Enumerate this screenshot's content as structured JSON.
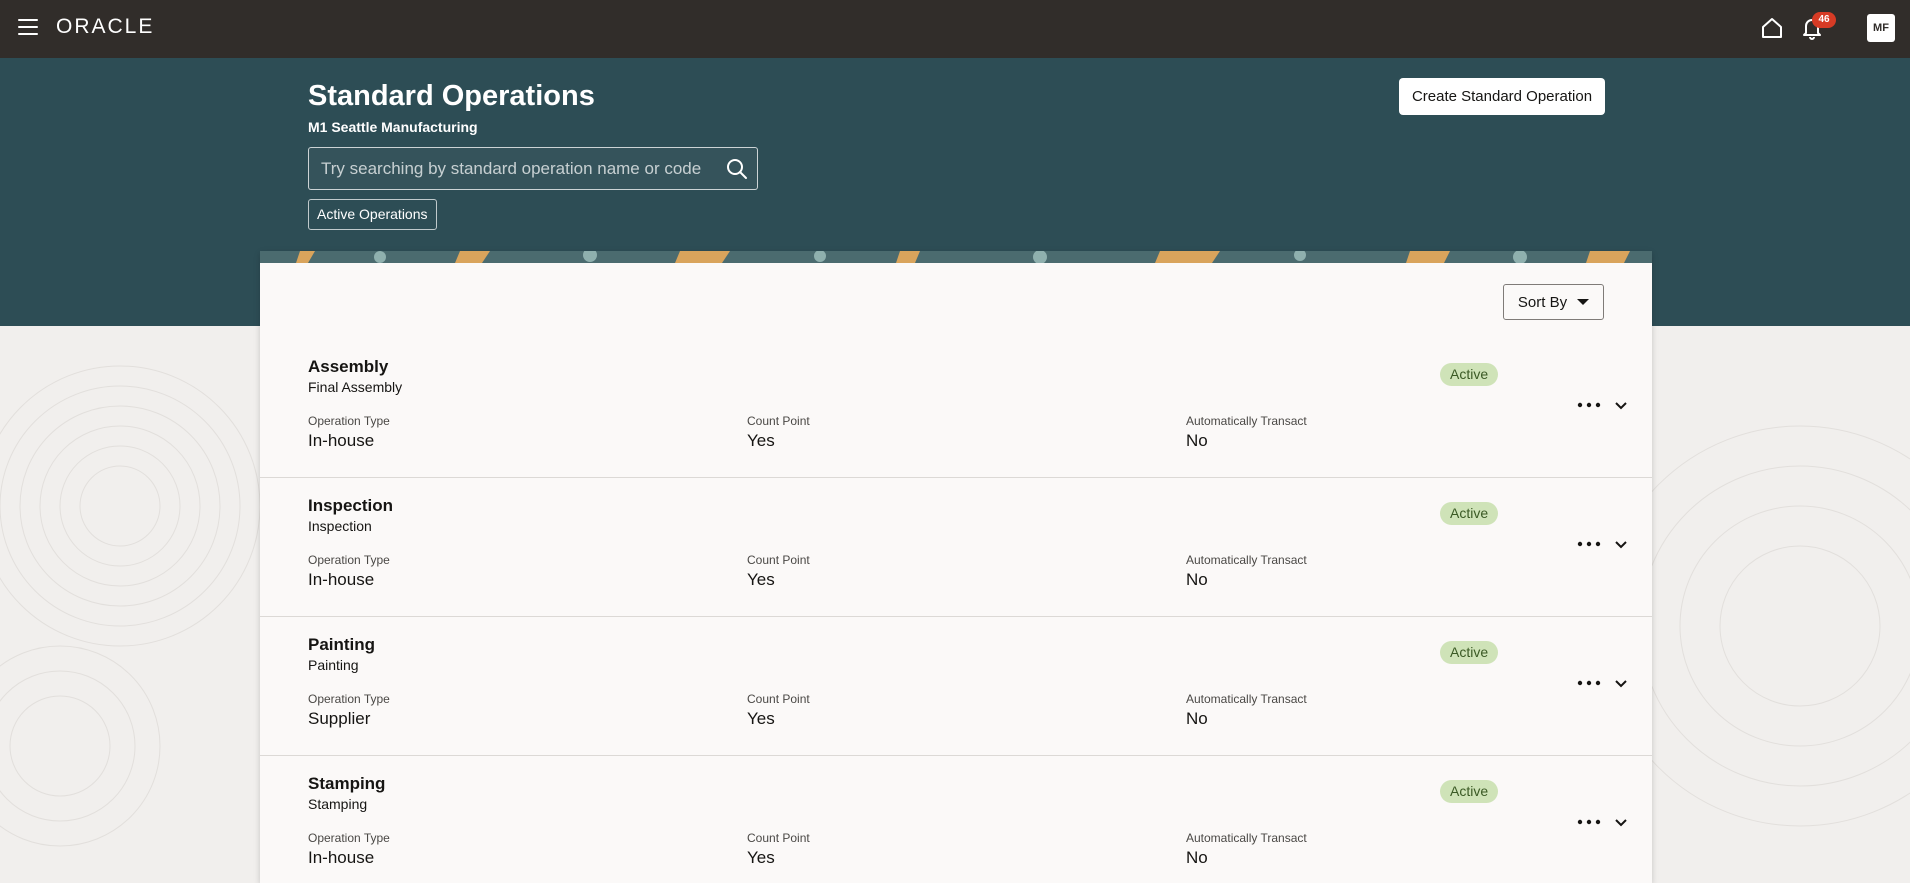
{
  "topbar": {
    "brand": "ORACLE",
    "notifications_count": "46",
    "avatar_initials": "MF",
    "icons": [
      "menu-icon",
      "home-icon",
      "bell-icon"
    ]
  },
  "header": {
    "title": "Standard Operations",
    "subtitle": "M1 Seattle Manufacturing",
    "search_placeholder": "Try searching by standard operation name or code",
    "filter_chip": "Active Operations",
    "create_button": "Create Standard Operation"
  },
  "toolbar": {
    "sort_label": "Sort By"
  },
  "operations": [
    {
      "name": "Assembly",
      "description": "Final Assembly",
      "status": "Active",
      "fields": [
        {
          "label": "Operation Type",
          "value": "In-house"
        },
        {
          "label": "Count Point",
          "value": "Yes"
        },
        {
          "label": "Automatically Transact",
          "value": "No"
        }
      ]
    },
    {
      "name": "Inspection",
      "description": "Inspection",
      "status": "Active",
      "fields": [
        {
          "label": "Operation Type",
          "value": "In-house"
        },
        {
          "label": "Count Point",
          "value": "Yes"
        },
        {
          "label": "Automatically Transact",
          "value": "No"
        }
      ]
    },
    {
      "name": "Painting",
      "description": "Painting",
      "status": "Active",
      "fields": [
        {
          "label": "Operation Type",
          "value": "Supplier"
        },
        {
          "label": "Count Point",
          "value": "Yes"
        },
        {
          "label": "Automatically Transact",
          "value": "No"
        }
      ]
    },
    {
      "name": "Stamping",
      "description": "Stamping",
      "status": "Active",
      "fields": [
        {
          "label": "Operation Type",
          "value": "In-house"
        },
        {
          "label": "Count Point",
          "value": "Yes"
        },
        {
          "label": "Automatically Transact",
          "value": "No"
        }
      ]
    }
  ],
  "colors": {
    "topbar": "#312d2a",
    "header_band": "#2d4d55",
    "status_bg": "#cfe3b8",
    "status_text": "#3b5a25",
    "badge": "#d63b25"
  }
}
